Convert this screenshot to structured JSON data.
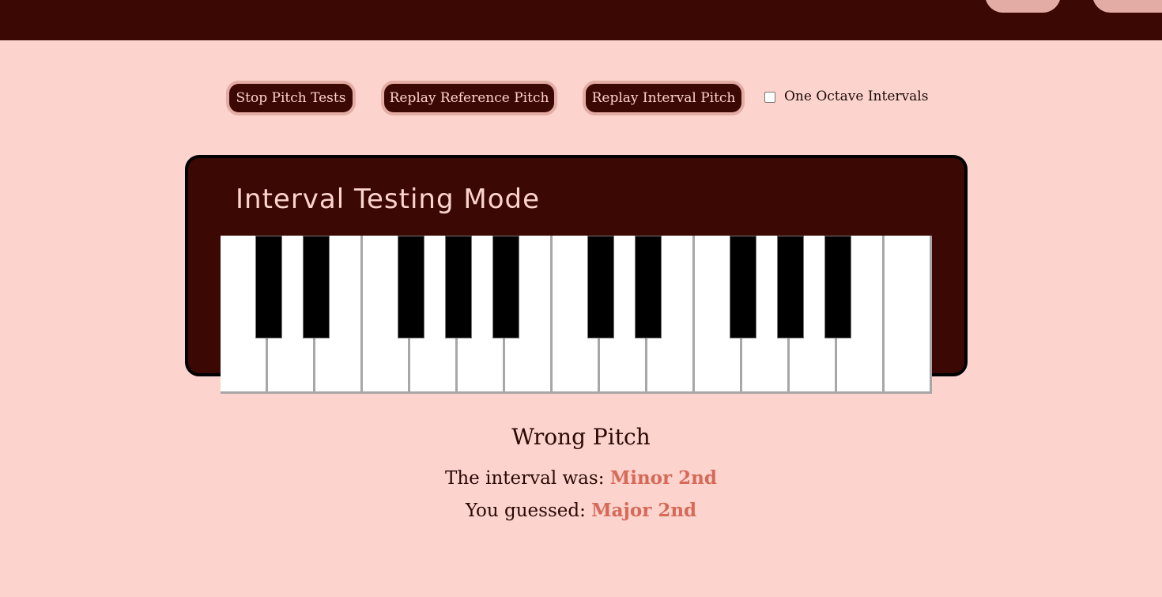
{
  "controls": {
    "stop_label": "Stop Pitch Tests",
    "replay_reference_label": "Replay Reference Pitch",
    "replay_interval_label": "Replay Interval Pitch",
    "one_octave_label": "One Octave Intervals",
    "one_octave_checked": false
  },
  "panel": {
    "title": "Interval Testing Mode"
  },
  "piano": {
    "white_keys": [
      "C",
      "D",
      "E",
      "F",
      "G",
      "A",
      "B",
      "C",
      "D",
      "E",
      "F",
      "G",
      "A",
      "B",
      "C"
    ],
    "black_keys": [
      "C#",
      "D#",
      "F#",
      "G#",
      "A#",
      "C#",
      "D#",
      "F#",
      "G#",
      "A#"
    ]
  },
  "result": {
    "title": "Wrong Pitch",
    "actual_prefix": "The interval was: ",
    "actual_value": "Minor 2nd",
    "guess_prefix": "You guessed: ",
    "guess_value": "Major 2nd"
  },
  "colors": {
    "background": "#fcd3cd",
    "dark": "#3c0804",
    "accent": "#e3aca4",
    "highlight": "#d56a58"
  }
}
